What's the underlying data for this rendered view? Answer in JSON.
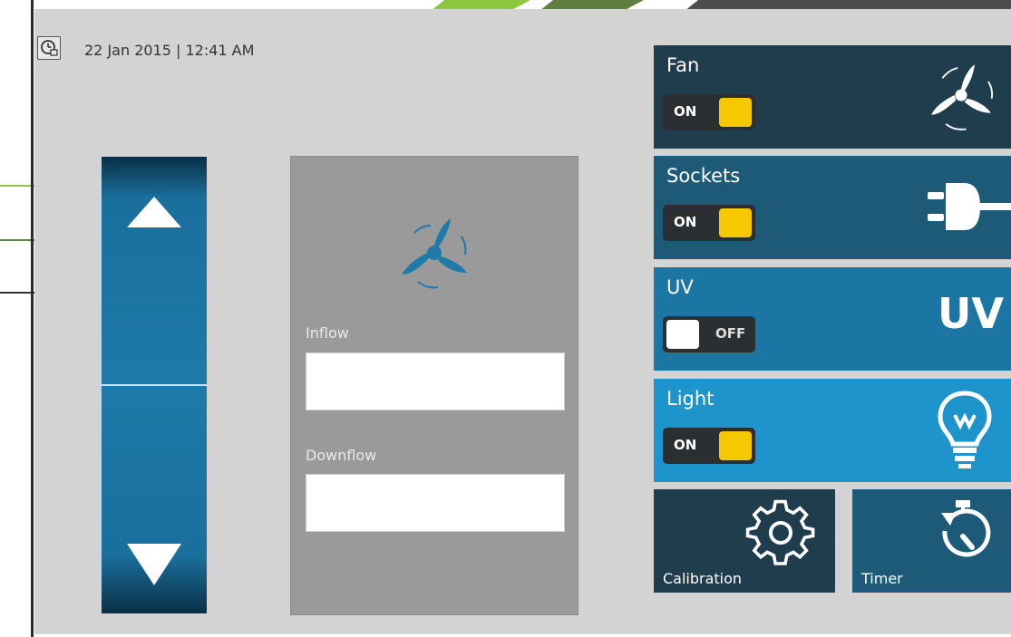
{
  "datetime": "22 Jan 2015 | 12:41 AM",
  "panel": {
    "inflow_label": "Inflow",
    "downflow_label": "Downflow",
    "inflow_value": "",
    "downflow_value": ""
  },
  "tiles": [
    {
      "title": "Fan",
      "state": "ON",
      "icon": "fan-icon",
      "bg": "#1f3d4d"
    },
    {
      "title": "Sockets",
      "state": "ON",
      "icon": "plug-icon",
      "bg": "#1c5a78"
    },
    {
      "title": "UV",
      "state": "OFF",
      "icon": "uv-text",
      "icon_text": "UV",
      "bg": "#1b76a3"
    },
    {
      "title": "Light",
      "state": "ON",
      "icon": "bulb-icon",
      "bg": "#1e94cc"
    }
  ],
  "bottom": {
    "calibration_label": "Calibration",
    "timer_label": "Timer"
  },
  "colors": {
    "accent_yellow": "#f6c800",
    "toggle_bg": "#2b2f32",
    "arrow_blue": "#1e7aa9",
    "calibration_bg": "#1f3d4d",
    "timer_bg": "#1c5a78"
  }
}
